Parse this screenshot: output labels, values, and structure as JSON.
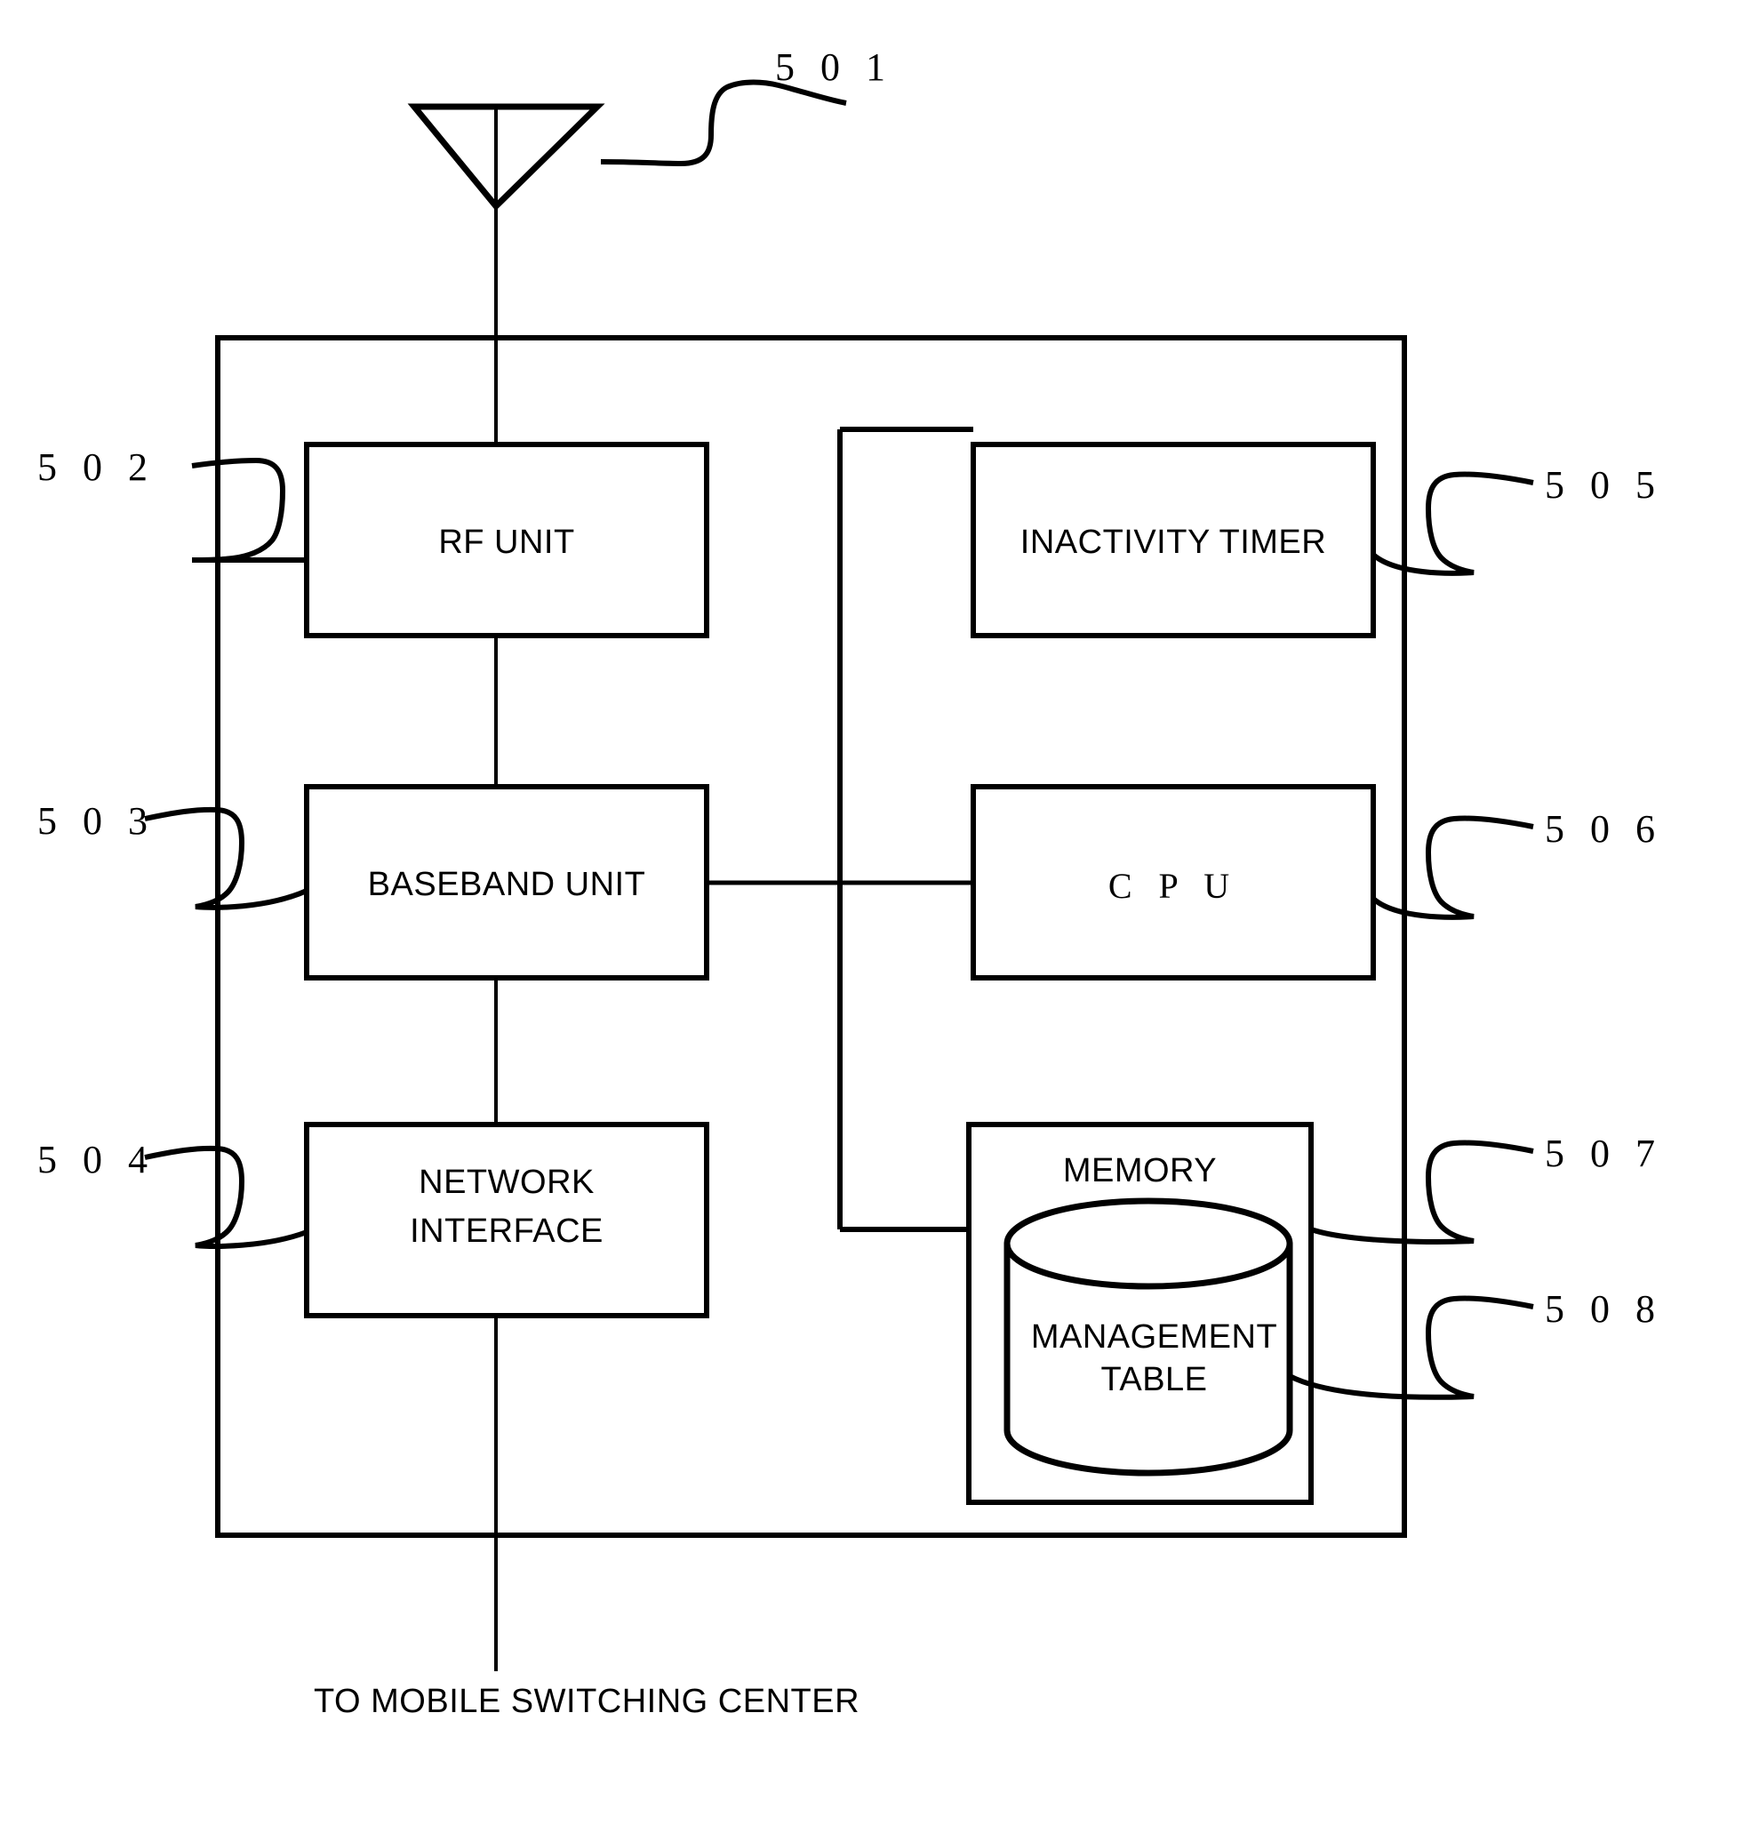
{
  "figure": {
    "type": "patent-block-diagram",
    "blocks": [
      {
        "id": "rf-unit",
        "label": "RF UNIT",
        "ref": "5 0 2"
      },
      {
        "id": "baseband-unit",
        "label": "BASEBAND UNIT",
        "ref": "5 0 3"
      },
      {
        "id": "network-interface",
        "label": "NETWORK\nINTERFACE",
        "ref": "5 0 4"
      },
      {
        "id": "inactivity-timer",
        "label": "INACTIVITY TIMER",
        "ref": "5 0 5"
      },
      {
        "id": "cpu",
        "label": "C P U",
        "ref": "5 0 6"
      },
      {
        "id": "memory",
        "label": "MEMORY",
        "ref": "5 0 7"
      },
      {
        "id": "management-table",
        "label": "MANAGEMENT\nTABLE",
        "ref": "5 0 8"
      }
    ],
    "antenna": {
      "ref": "5 0 1"
    },
    "caption": "TO MOBILE SWITCHING CENTER",
    "refs": {
      "antenna": "5 0 1",
      "rf_unit": "5 0 2",
      "baseband_unit": "5 0 3",
      "network_interface": "5 0 4",
      "inactivity_timer": "5 0 5",
      "cpu": "5 0 6",
      "memory": "5 0 7",
      "management_table": "5 0 8"
    },
    "labels": {
      "rf_unit": "RF UNIT",
      "baseband_unit": "BASEBAND UNIT",
      "network_interface": "NETWORK\nINTERFACE",
      "inactivity_timer": "INACTIVITY TIMER",
      "cpu": "C P U",
      "memory": "MEMORY",
      "management_table": "MANAGEMENT\nTABLE",
      "caption": "TO MOBILE SWITCHING CENTER"
    },
    "colors": {
      "ink": "#000000",
      "paper": "#ffffff"
    }
  }
}
